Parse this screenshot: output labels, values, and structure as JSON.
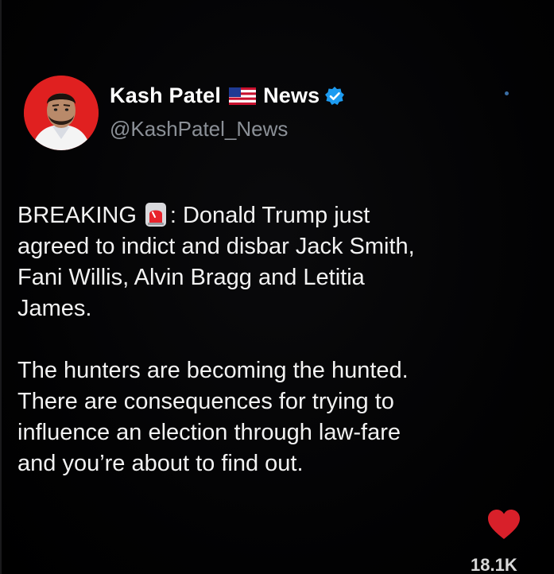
{
  "post": {
    "author": {
      "name_first": "Kash Patel",
      "name_second": "News",
      "handle": "@KashPatel_News",
      "avatar_icon": "avatar-photo",
      "flag_icon": "us-flag-icon",
      "verified_icon": "verified-badge-icon"
    },
    "text": {
      "paragraph1_lines": [
        "BREAKING",
        ": Donald Trump just",
        "agreed to indict and disbar Jack Smith,",
        "Fani Willis, Alvin Bragg and Letitia",
        "James."
      ],
      "paragraph2_lines": [
        "The hunters are becoming the hunted.",
        "There are consequences for trying to",
        "influence an election through law-fare",
        "and you’re about to find out."
      ],
      "siren_icon": "siren-emoji-icon"
    },
    "reaction": {
      "icon": "heart-icon",
      "count": "18.1K"
    }
  },
  "colors": {
    "background": "#000000",
    "text": "#f2f2f2",
    "handle": "#8b9097",
    "verified": "#1d9bf0",
    "avatar_bg": "#e02020",
    "heart": "#d8202a"
  }
}
